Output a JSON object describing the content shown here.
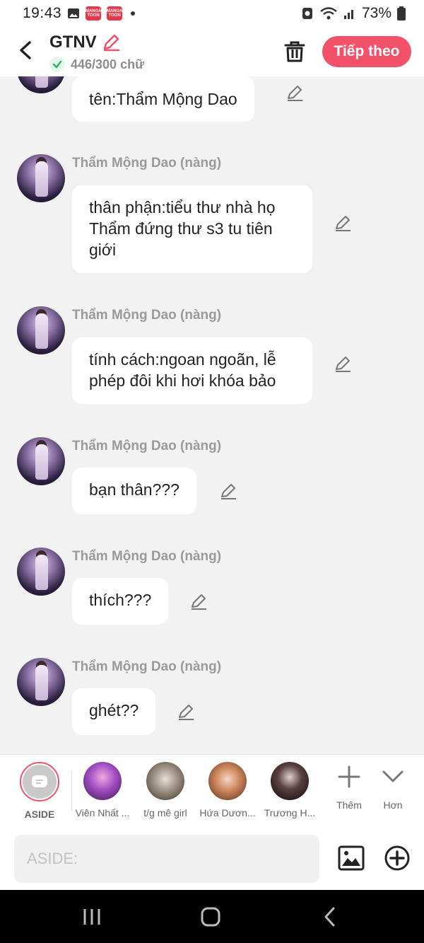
{
  "status_bar": {
    "time": "19:43",
    "app_badge_text": "MANGA TOON",
    "battery": "73%"
  },
  "header": {
    "title": "GTNV",
    "word_count": "446/300 chữ",
    "next_label": "Tiếp theo"
  },
  "messages": [
    {
      "sender": "",
      "text": "tên:Thẩm Mộng Dao"
    },
    {
      "sender": "Thẩm Mộng Dao (nàng)",
      "text": "thân phận:tiểu thư nhà họ Thẩm đứng thư s3 tu tiên giới"
    },
    {
      "sender": "Thẩm Mộng Dao (nàng)",
      "text": "tính cách:ngoan ngoãn, lễ phép đôi khi hơi khóa bảo"
    },
    {
      "sender": "Thẩm Mộng Dao (nàng)",
      "text": "bạn thân???"
    },
    {
      "sender": "Thẩm Mộng Dao (nàng)",
      "text": "thích???"
    },
    {
      "sender": "Thẩm Mộng Dao (nàng)",
      "text": "ghét??"
    }
  ],
  "characters": [
    {
      "name": "ASIDE",
      "selected": true
    },
    {
      "name": "Viên Nhất ...",
      "selected": false
    },
    {
      "name": "t/g mê girl",
      "selected": false
    },
    {
      "name": "Hứa Dươn...",
      "selected": false
    },
    {
      "name": "Trương H...",
      "selected": false
    }
  ],
  "char_actions": {
    "add_label": "Thêm",
    "more_label": "Hơn"
  },
  "input": {
    "placeholder": "ASIDE:"
  },
  "colors": {
    "accent": "#f2516a",
    "bubble": "#ffffff",
    "chat_bg": "#f2f2f2"
  }
}
